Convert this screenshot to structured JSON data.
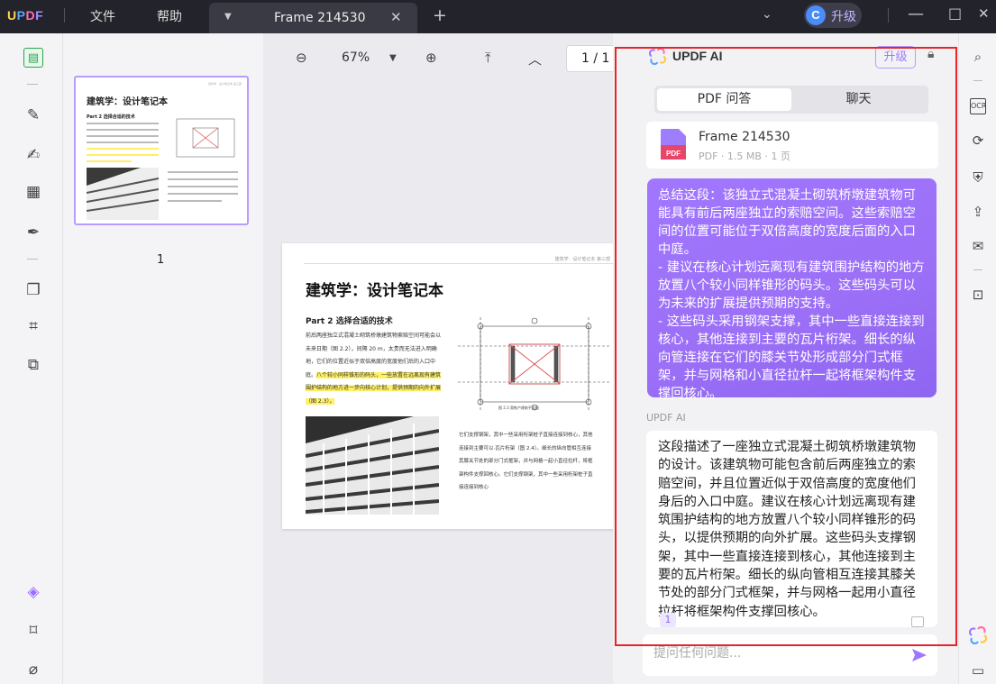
{
  "app": {
    "logo": "UPDF",
    "menu": [
      "文件",
      "帮助"
    ],
    "tab_title": "Frame 214530",
    "upgrade_label": "升级",
    "avatar_letter": "C"
  },
  "toolbar": {
    "zoom": "67%",
    "page_indicator": "1 / 1"
  },
  "thumbnails": {
    "page_label": "1",
    "title": "建筑学：设计笔记本",
    "subtitle": "Part 2  选择合适的技术"
  },
  "document": {
    "header": "建筑学 · 设计笔记本 第三部",
    "title": "建筑学：设计笔记本",
    "section": "Part 2   选择合适的技术",
    "para1_a": "前后两座独立式混凝土砌筑桥墩建筑物索赔空间可能会以未来日期（图 2.2），间隔 20 m，太贵而无法进入明确地，它们的位置近似于双倍高度的宽度他们后的入口中庭。",
    "para1_hl": "八个较小同样锥形的码头，一些放置在远离现有建筑围护结构的地方进一步向核心计划，提供预期的向外扩展（图 2.3）。",
    "plan_caption": "图 2.3 滑铁卢建筑平面图",
    "para2": "它们支撑钢架，其中一些采用桁架桩子直接连接到核心，其他连接到主要可以·瓦片桁架（图 2.4）。细长的纵向管相互连接其膝关节处的部分门式框架，并与网格一起小直径拉杆，将框架构件支撑回核心。它们支撑钢架，其中一些采用桁架桩子直接连接到核心"
  },
  "ai_panel": {
    "title": "UPDF AI",
    "upgrade": "升级",
    "tabs": [
      "PDF 问答",
      "聊天"
    ],
    "file": {
      "name": "Frame 214530",
      "meta": "PDF · 1.5 MB · 1 页"
    },
    "prompt": "总结这段：该独立式混凝土砌筑桥墩建筑物可能具有前后两座独立的索赔空间。这些索赔空间的位置可能位于双倍高度的宽度后面的入口中庭。\n- 建议在核心计划远离现有建筑围护结构的地方放置八个较小同样锥形的码头。这些码头可以为未来的扩展提供预期的支持。\n- 这些码头采用钢架支撑，其中一些直接连接到核心，其他连接到主要的瓦片桁架。细长的纵向管连接在它们的膝关节处形成部分门式框架，并与网格和小直径拉杆一起将框架构件支撑回核心。",
    "answer_label": "UPDF AI",
    "answer": "这段描述了一座独立式混凝土砌筑桥墩建筑物的设计。该建筑物可能包含前后两座独立的索赔空间，并且位置近似于双倍高度的宽度他们身后的入口中庭。建议在核心计划远离现有建筑围护结构的地方放置八个较小同样锥形的码头，以提供预期的向外扩展。这些码头支撑钢架，其中一些直接连接到核心，其他连接到主要的瓦片桁架。细长的纵向管相互连接其膝关节处的部分门式框架，并与网格一起用小直径拉杆将框架构件支撑回核心。",
    "reference": "1",
    "input_placeholder": "提问任何问题..."
  },
  "colors": {
    "accent": "#9c6ff8",
    "highlight_box": "#e5252a",
    "titlebar": "#23232b"
  }
}
